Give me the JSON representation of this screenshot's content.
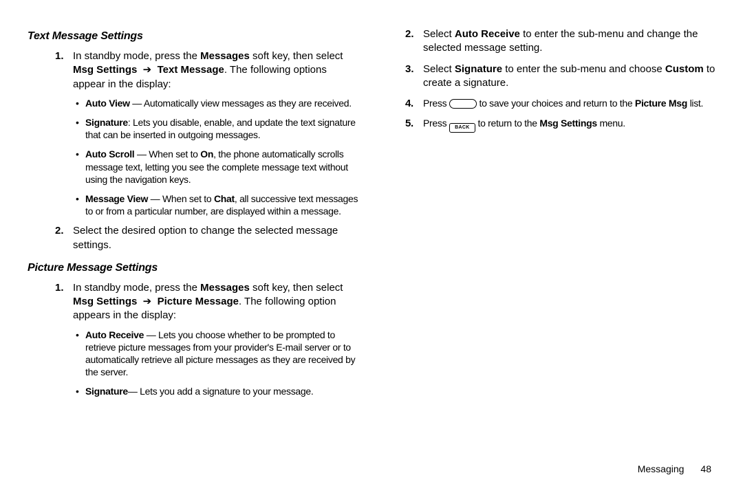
{
  "section1": {
    "title": "Text Message Settings",
    "steps": [
      {
        "num": "1.",
        "html": "In standby mode, press the <b>Messages</b> soft key, then select <b>Msg Settings</b> &nbsp;➔&nbsp; <b>Text Message</b>. The following options appear in the display:",
        "bullets": [
          "<b>Auto View</b> — Automatically view messages as they are received.",
          "<b>Signature</b>: Lets you disable, enable, and update the text signature that can be inserted in outgoing messages.",
          "<b>Auto Scroll</b> — When set to <b>On</b>, the phone automatically scrolls message text, letting you see the complete message text without using the navigation keys.",
          "<b>Message View</b> — When set to <b>Chat</b>, all successive text messages to or from a particular number, are displayed within a message."
        ]
      },
      {
        "num": "2.",
        "html": "Select the desired option to change the selected message settings."
      }
    ]
  },
  "section2": {
    "title": "Picture Message Settings",
    "steps": [
      {
        "num": "1.",
        "html": "In standby mode, press the <b>Messages</b> soft key, then select <b>Msg Settings</b> &nbsp;➔&nbsp; <b>Picture Message</b>. The following option appears in the display:",
        "bullets": [
          "<b>Auto Receive</b> — Lets you choose whether to be prompted to retrieve picture messages from your provider's E-mail server or to automatically retrieve all picture messages as they are received by the server.",
          "<b>Signature</b>— Lets you add a signature to your message."
        ]
      }
    ]
  },
  "rightSteps": [
    {
      "num": "2.",
      "html": "Select <b>Auto Receive</b> to enter the sub-menu and change the selected message setting."
    },
    {
      "num": "3.",
      "html": "Select <b>Signature</b> to enter the sub-menu and choose <b>Custom</b> to create a signature."
    },
    {
      "num": "4.",
      "html": "Press <span class=\"key-pill\" data-name=\"ok-key-icon\" data-interactable=\"false\"></span> to save your choices and return to the <b>Picture Msg</b> list.",
      "condensed": true
    },
    {
      "num": "5.",
      "html": "Press <span class=\"key-back\" data-name=\"back-key-icon\" data-interactable=\"false\">BACK</span> to return to the <b>Msg Settings</b> menu.",
      "condensed": true
    }
  ],
  "footer": {
    "section": "Messaging",
    "page": "48"
  }
}
